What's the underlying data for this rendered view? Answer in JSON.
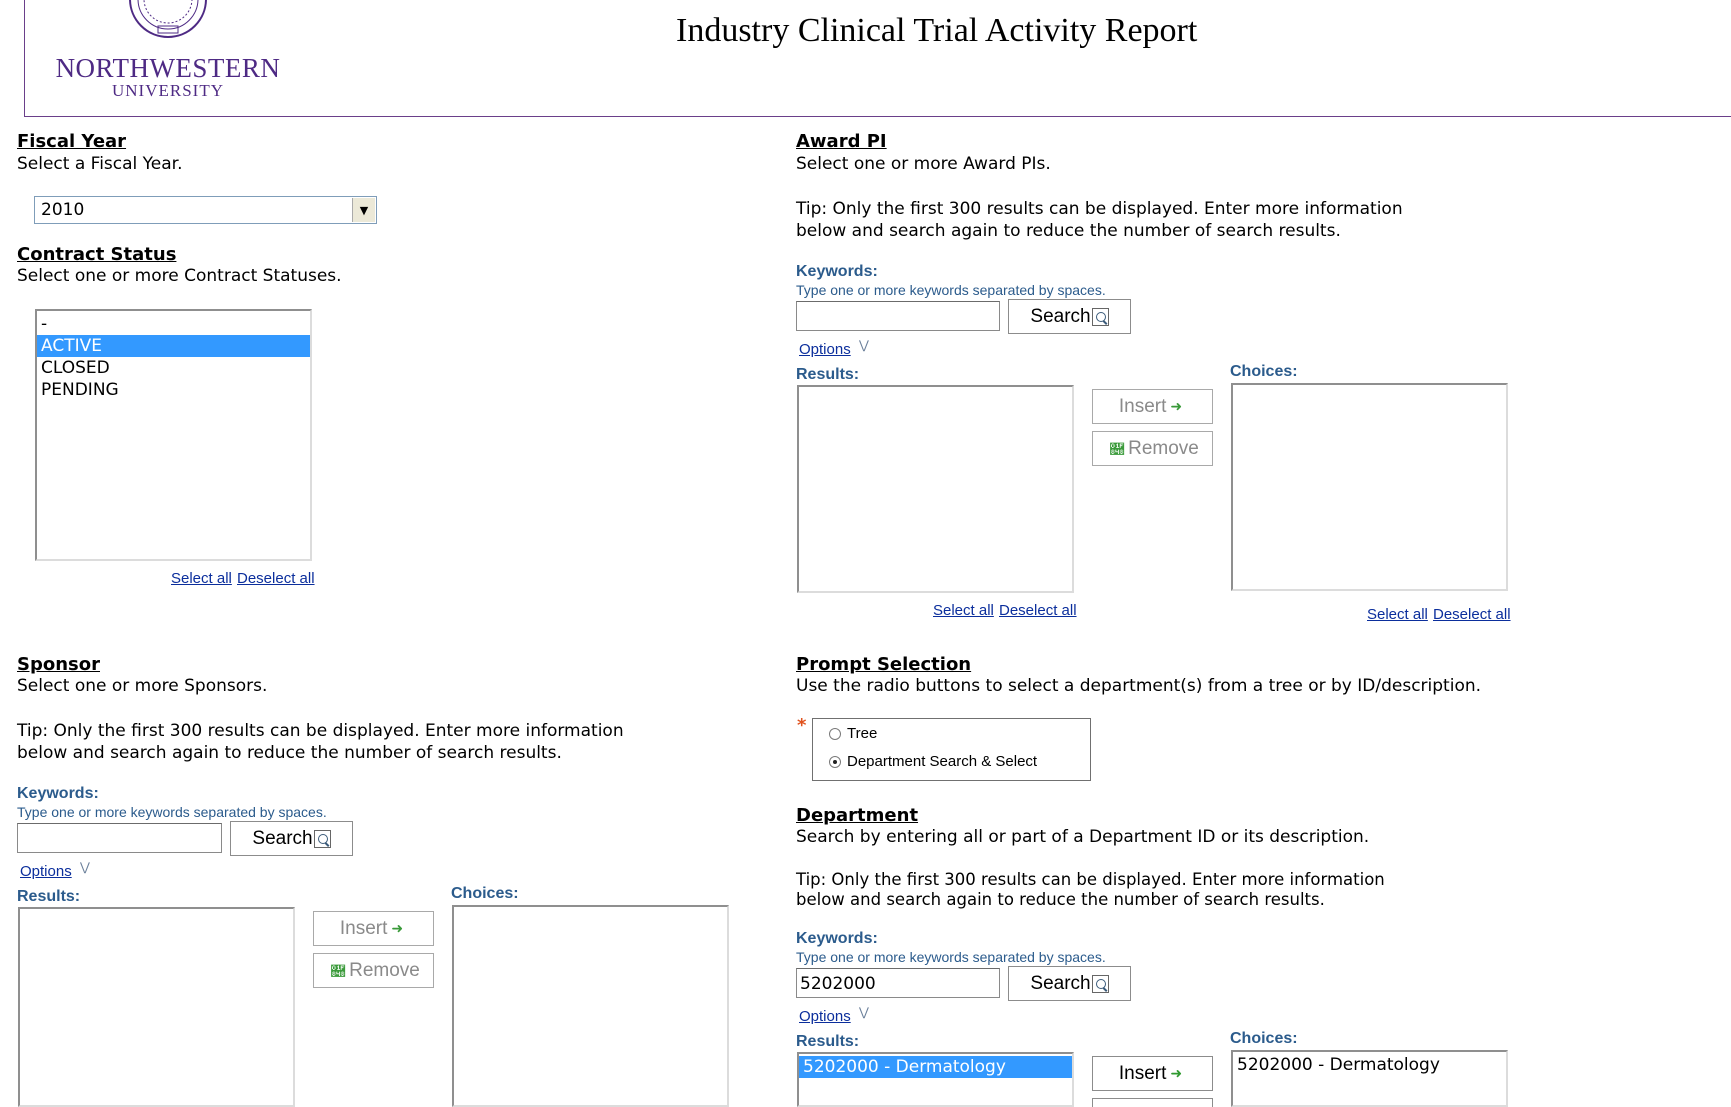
{
  "header": {
    "logo_line1": "NORTHWESTERN",
    "logo_line2": "UNIVERSITY",
    "title": "Industry Clinical Trial Activity Report"
  },
  "fiscal_year": {
    "title": "Fiscal Year",
    "description": "Select a Fiscal Year.",
    "selected": "2010"
  },
  "contract_status": {
    "title": "Contract Status",
    "description": "Select one or more Contract Statuses.",
    "items": [
      {
        "label": "-",
        "selected": false
      },
      {
        "label": "ACTIVE",
        "selected": true
      },
      {
        "label": "CLOSED",
        "selected": false
      },
      {
        "label": "PENDING",
        "selected": false
      }
    ],
    "select_all": "Select all",
    "deselect_all": "Deselect all"
  },
  "common": {
    "tip_line1": "Tip: Only the first 300 results can be displayed. Enter more information",
    "tip_line2": "below and search again to reduce the number of search results.",
    "keywords_label": "Keywords:",
    "keywords_hint": "Type one or more keywords separated by spaces.",
    "search_label": "Search",
    "options_label": "Options",
    "results_label": "Results:",
    "choices_label": "Choices:",
    "insert_label": "Insert",
    "remove_label": "Remove",
    "select_all": "Select all",
    "deselect_all": "Deselect all"
  },
  "award_pi": {
    "title": "Award PI",
    "description": "Select one or more Award PIs.",
    "keywords_value": ""
  },
  "sponsor": {
    "title": "Sponsor",
    "description": "Select one or more Sponsors.",
    "keywords_value": ""
  },
  "prompt_selection": {
    "title": "Prompt Selection",
    "description": "Use the radio buttons to select a department(s) from a tree or by ID/description.",
    "required_marker": "*",
    "options": [
      {
        "label": "Tree",
        "checked": false
      },
      {
        "label": "Department Search & Select",
        "checked": true
      }
    ]
  },
  "department": {
    "title": "Department",
    "description": "Search by entering all or part of a Department ID or its description.",
    "keywords_value": "5202000",
    "results": [
      "5202000 - Dermatology"
    ],
    "choices": [
      "5202000 - Dermatology"
    ]
  },
  "icons": {
    "search": "magnifier-icon",
    "options": "chevron-down-icon",
    "insert": "arrow-right-icon",
    "remove": "arrow-left-icon"
  },
  "colors": {
    "brand_purple": "#4e2a84",
    "label_blue": "#2b5b8c",
    "link_blue": "#0b2e9c",
    "selection": "#3399ff",
    "required": "#e0531f"
  }
}
